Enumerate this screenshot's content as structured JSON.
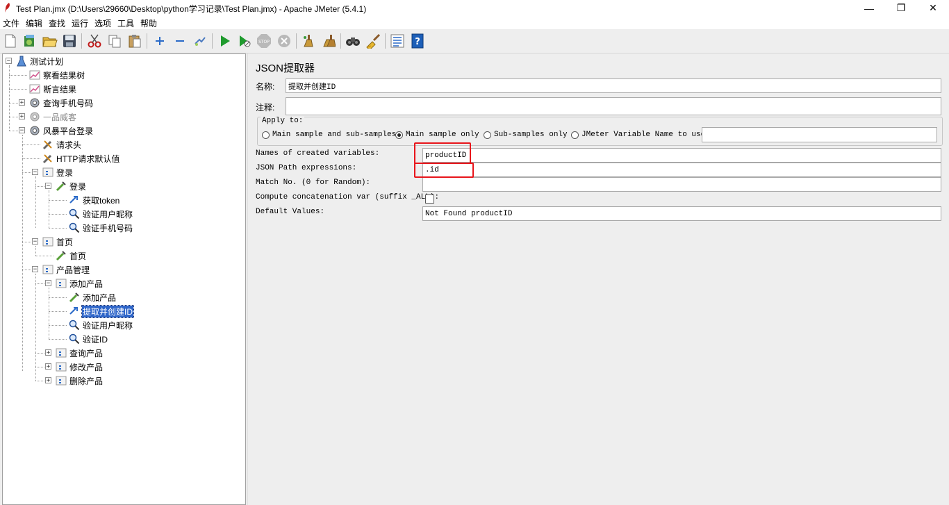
{
  "window": {
    "title": "Test Plan.jmx (D:\\Users\\29660\\Desktop\\python学习记录\\Test Plan.jmx) - Apache JMeter (5.4.1)",
    "minimize": "—",
    "restore": "❐",
    "close": "✕"
  },
  "menu": [
    "文件",
    "编辑",
    "查找",
    "运行",
    "选项",
    "工具",
    "帮助"
  ],
  "tree": {
    "root": "测试计划",
    "view_results_tree": "察看结果树",
    "assertion_results": "断言结果",
    "query_phone": "查询手机号码",
    "yipin": "一品威客",
    "fengbao_login": "风暴平台登录",
    "request_header": "请求头",
    "http_defaults": "HTTP请求默认值",
    "login_controller": "登录",
    "login_sampler": "登录",
    "get_token": "获取token",
    "verify_nickname": "验证用户昵称",
    "verify_phone": "验证手机号码",
    "home_controller": "首页",
    "home_sampler": "首页",
    "product_mgmt": "产品管理",
    "add_product_controller": "添加产品",
    "add_product_sampler": "添加产品",
    "extract_id": "提取并创建ID",
    "verify_nickname2": "验证用户昵称",
    "verify_id": "验证ID",
    "query_product": "查询产品",
    "modify_product": "修改产品",
    "delete_product": "删除产品"
  },
  "editor": {
    "heading": "JSON提取器",
    "name_label": "名称:",
    "name_value": "提取并创建ID",
    "comment_label": "注释:",
    "comment_value": "",
    "apply_to": {
      "legend": "Apply to:",
      "main_and_sub": "Main sample and sub-samples",
      "main_only": "Main sample only",
      "sub_only": "Sub-samples only",
      "jmeter_var": "JMeter Variable Name to use",
      "var_value": "",
      "selected": "main_only"
    },
    "names_label": "Names of created variables:",
    "names_value": "productID",
    "path_label": "JSON Path expressions:",
    "path_value": ".id",
    "match_label": "Match No. (0 for Random):",
    "match_value": "",
    "concat_label": "Compute concatenation var (suffix _ALL):",
    "default_label": "Default Values:",
    "default_value": "Not Found productID"
  },
  "colors": {
    "selection": "#2f66c9",
    "highlight_box": "#e8141a"
  }
}
